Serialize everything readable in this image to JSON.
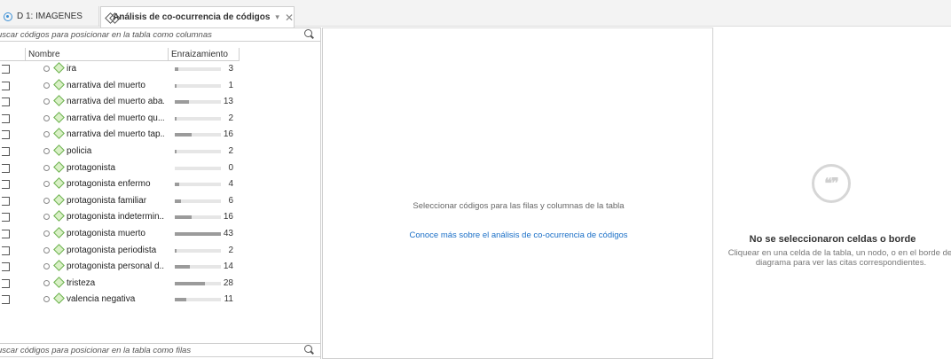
{
  "tabs": {
    "doc_tab_label": "D 1: IMAGENES",
    "active_tab_label": "Análisis de co-ocurrencia de códigos",
    "active_tab_menu": "▾",
    "active_tab_close": "✕"
  },
  "left": {
    "search_columns_placeholder": "uscar códigos para posicionar en la tabla como columnas",
    "search_rows_placeholder": "uscar códigos para posicionar en la tabla como filas",
    "header_name": "Nombre",
    "header_rooting": "Enraizamiento",
    "max_rooting": 43,
    "codes": [
      {
        "name": "ira",
        "rooting": 3
      },
      {
        "name": "narrativa del muerto",
        "rooting": 1
      },
      {
        "name": "narrativa del muerto aba...",
        "rooting": 13
      },
      {
        "name": "narrativa del muerto qu...",
        "rooting": 2
      },
      {
        "name": "narrativa del muerto tap...",
        "rooting": 16
      },
      {
        "name": "policia",
        "rooting": 2
      },
      {
        "name": "protagonista",
        "rooting": 0
      },
      {
        "name": "protagonista enfermo",
        "rooting": 4
      },
      {
        "name": "protagonista familiar",
        "rooting": 6
      },
      {
        "name": "protagonista indetermin...",
        "rooting": 16
      },
      {
        "name": "protagonista muerto",
        "rooting": 43
      },
      {
        "name": "protagonista periodista",
        "rooting": 2
      },
      {
        "name": "protagonista personal d...",
        "rooting": 14
      },
      {
        "name": "tristeza",
        "rooting": 28
      },
      {
        "name": "valencia negativa",
        "rooting": 11
      }
    ]
  },
  "middle": {
    "message": "Seleccionar códigos para las filas y columnas de la tabla",
    "link": "Conoce más sobre el análisis de co-ocurrencia de códigos"
  },
  "right": {
    "quote_glyph": "❝❞",
    "title": "No se seleccionaron celdas o borde",
    "description": "Cliquear en una celda de la tabla, un nodo, o en el borde del diagrama para ver las citas correspondientes."
  },
  "colors": {
    "link": "#1a6fc7",
    "code_icon": "#6ab04c",
    "bar_fill": "#9b9b9b"
  }
}
